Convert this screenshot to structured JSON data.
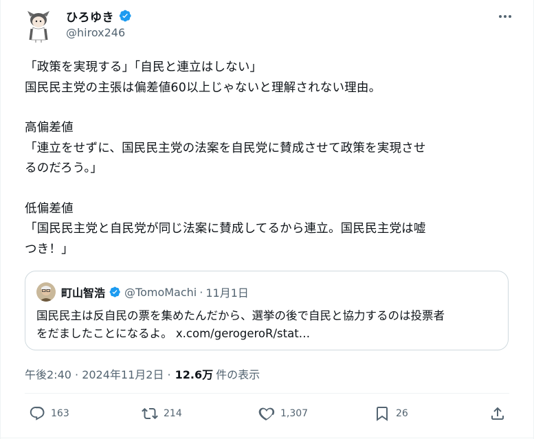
{
  "author": {
    "display_name": "ひろゆき",
    "handle": "@hirox246"
  },
  "body": {
    "lines": [
      "「政策を実現する」「自民と連立はしない」",
      "国民民主党の主張は偏差値60以上じゃないと理解されない理由。",
      "",
      "高偏差値",
      "「連立をせずに、国民民主党の法案を自民党に賛成させて政策を実現させ",
      "るのだろう。」",
      "",
      "低偏差値",
      "「国民民主党と自民党が同じ法案に賛成してるから連立。国民民主党は嘘",
      "つき！」"
    ]
  },
  "quote": {
    "display_name": "町山智浩",
    "handle": "@TomoMachi",
    "separator": "·",
    "date": "11月1日",
    "text_line1": "国民民主は反自民の票を集めたんだから、選挙の後で自民と協力するのは投票者",
    "text_line2": "をだましたことになるよ。",
    "link": "x.com/gerogeroR/stat…"
  },
  "meta": {
    "time_date": "午後2:40 · 2024年11月2日 ·",
    "views": "12.6万",
    "views_label": "件の表示"
  },
  "actions": {
    "replies": "163",
    "reposts": "214",
    "likes": "1,307",
    "bookmarks": "26"
  },
  "colors": {
    "verified": "#1d9bf0",
    "secondary_text": "#536471",
    "primary_text": "#0f1419",
    "border": "#cfd9de"
  }
}
